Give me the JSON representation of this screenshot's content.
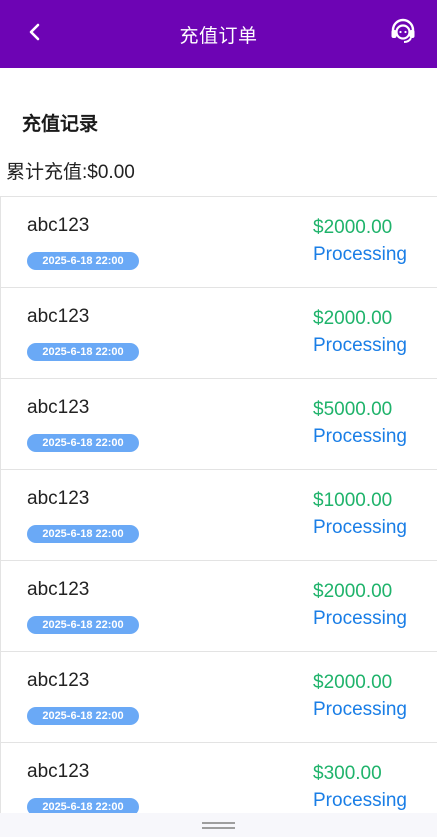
{
  "header": {
    "title": "充值订单"
  },
  "section": {
    "title": "充值记录",
    "total": "累计充值:$0.00"
  },
  "colors": {
    "header_bg": "#6d04b4",
    "amount": "#1fb36b",
    "status": "#1a7ee6",
    "date_badge": "#6aa9f6"
  },
  "icons": {
    "back": "chevron-left-icon",
    "support": "headset-icon"
  },
  "records": [
    {
      "name": "abc123",
      "date": "2025-6-18 22:00",
      "amount": "$2000.00",
      "status": "Processing"
    },
    {
      "name": "abc123",
      "date": "2025-6-18 22:00",
      "amount": "$2000.00",
      "status": "Processing"
    },
    {
      "name": "abc123",
      "date": "2025-6-18 22:00",
      "amount": "$5000.00",
      "status": "Processing"
    },
    {
      "name": "abc123",
      "date": "2025-6-18 22:00",
      "amount": "$1000.00",
      "status": "Processing"
    },
    {
      "name": "abc123",
      "date": "2025-6-18 22:00",
      "amount": "$2000.00",
      "status": "Processing"
    },
    {
      "name": "abc123",
      "date": "2025-6-18 22:00",
      "amount": "$2000.00",
      "status": "Processing"
    },
    {
      "name": "abc123",
      "date": "2025-6-18 22:00",
      "amount": "$300.00",
      "status": "Processing"
    }
  ]
}
